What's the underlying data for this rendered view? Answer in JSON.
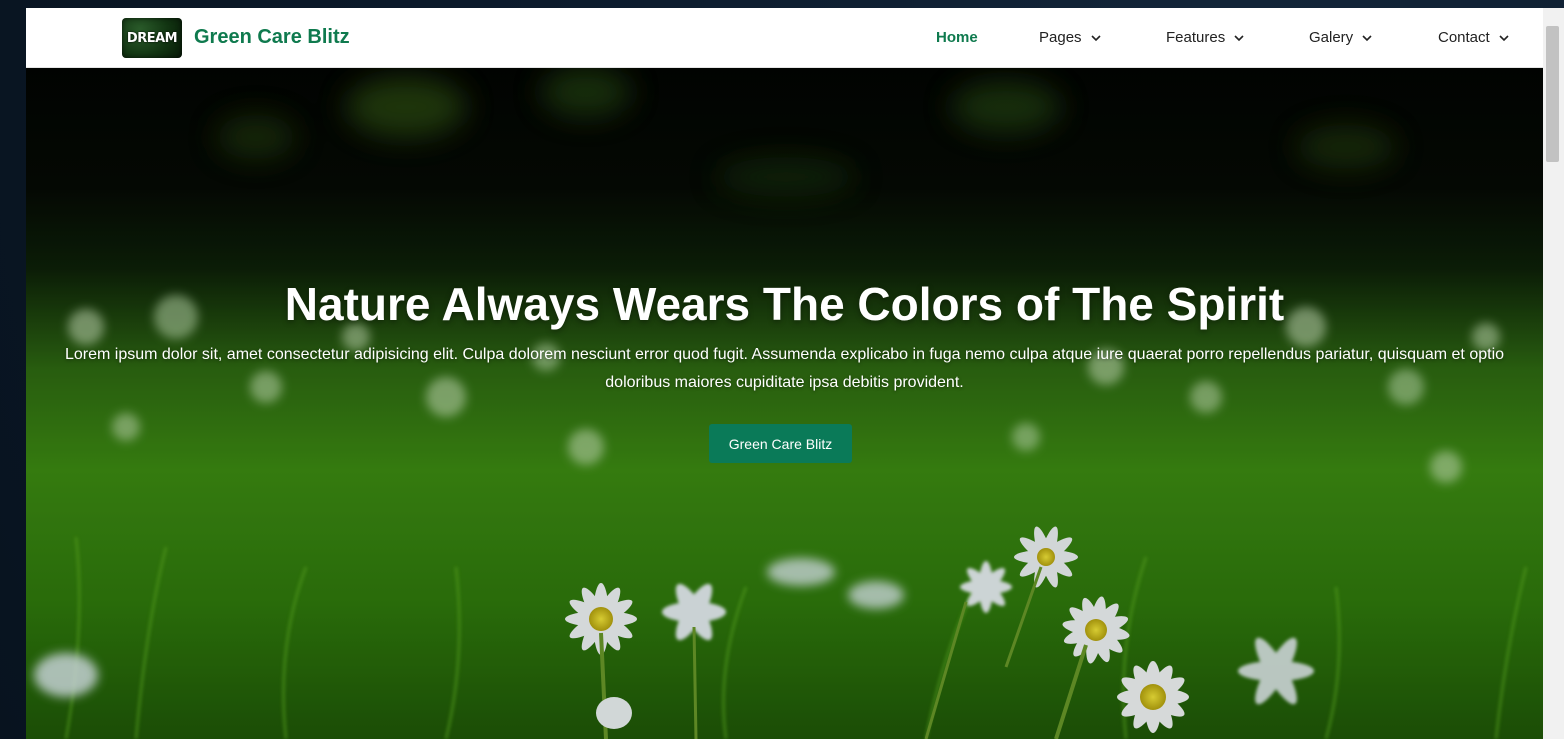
{
  "navbar": {
    "logo_text": "DREAM",
    "brand_name": "Green Care Blitz",
    "items": [
      {
        "label": "Home",
        "active": true,
        "dropdown": false
      },
      {
        "label": "Pages",
        "active": false,
        "dropdown": true
      },
      {
        "label": "Features",
        "active": false,
        "dropdown": true
      },
      {
        "label": "Galery",
        "active": false,
        "dropdown": true
      },
      {
        "label": "Contact",
        "active": false,
        "dropdown": true
      }
    ]
  },
  "hero": {
    "title": "Nature Always Wears The Colors of The Spirit",
    "text": "Lorem ipsum dolor sit, amet consectetur adipisicing elit. Culpa dolorem nesciunt error quod fugit. Assumenda explicabo in fuga nemo culpa atque iure quaerat porro repellendus pariatur, quisquam et optio doloribus maiores cupiditate ipsa debitis provident.",
    "button_label": "Green Care Blitz",
    "background_image": "grass-and-daisies-photo"
  },
  "colors": {
    "brand": "#0f7a4e",
    "button": "#0a7a58",
    "page_backdrop": "#0b1a2b"
  }
}
